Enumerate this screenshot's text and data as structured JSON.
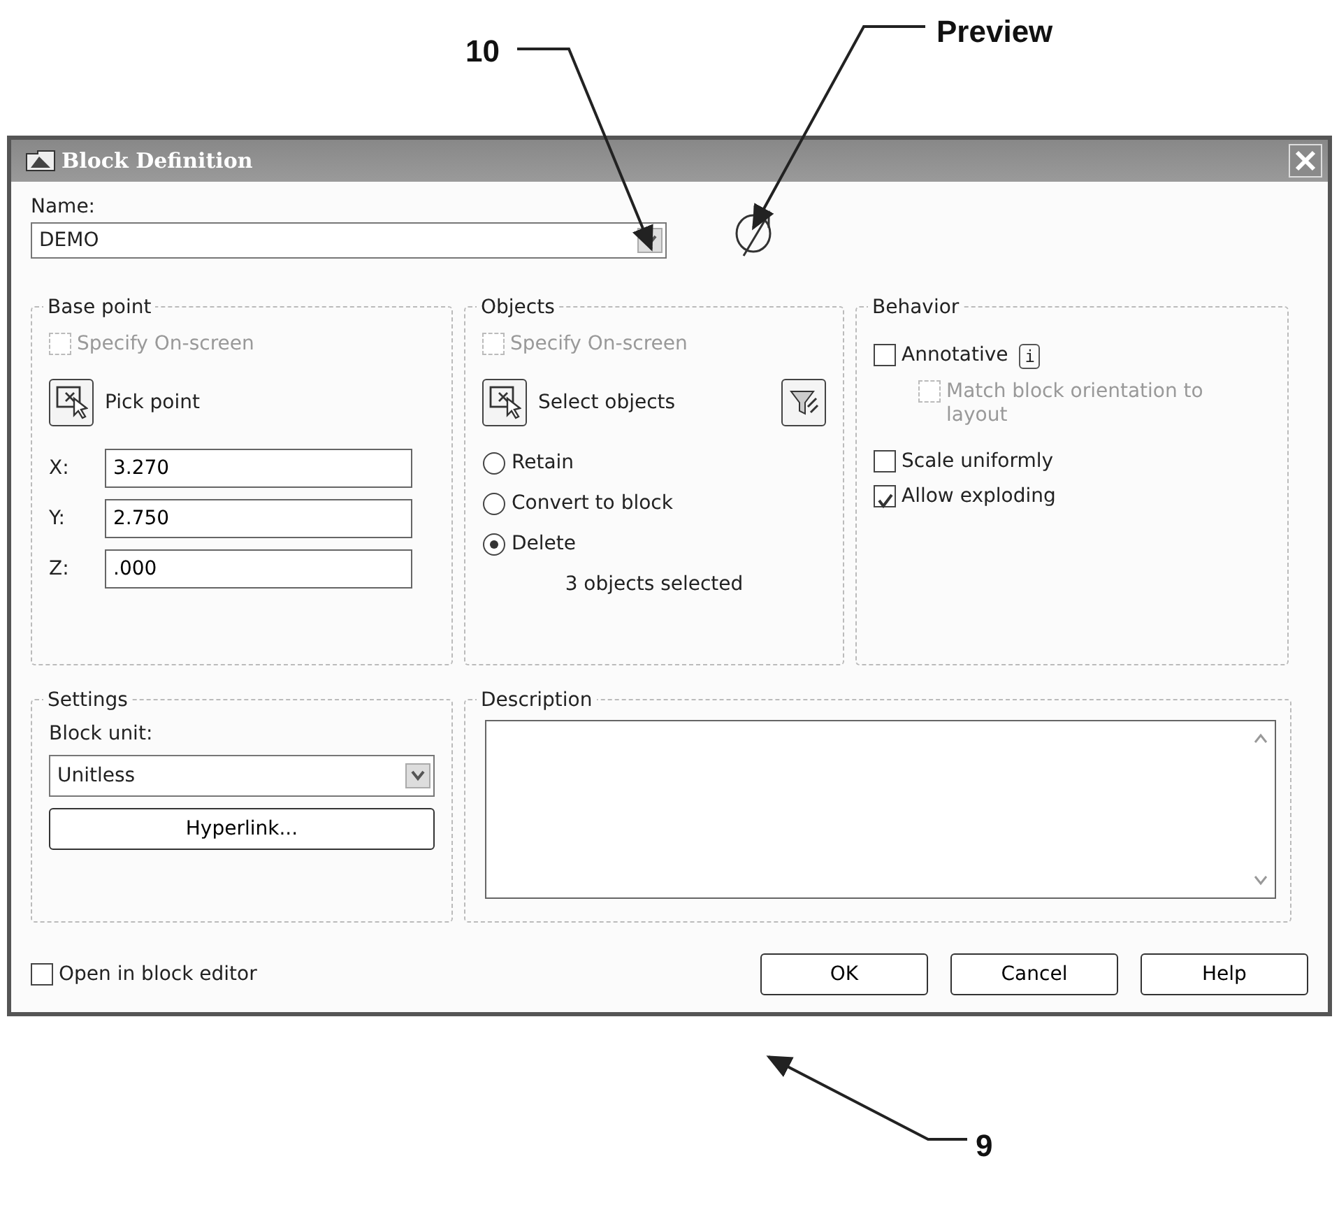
{
  "callouts": [
    {
      "label": "10"
    },
    {
      "label": "Preview"
    },
    {
      "label": "9"
    }
  ],
  "window": {
    "title": "Block Definition"
  },
  "name": {
    "label": "Name:",
    "value": "DEMO"
  },
  "base_point": {
    "title": "Base point",
    "specify": {
      "label": "Specify On-screen",
      "checked": false,
      "disabled": true
    },
    "pick_button": "Pick point",
    "coords": [
      {
        "label": "X:",
        "value": "3.270"
      },
      {
        "label": "Y:",
        "value": "2.750"
      },
      {
        "label": "Z:",
        "value": ".000"
      }
    ]
  },
  "objects": {
    "title": "Objects",
    "specify": {
      "label": "Specify On-screen",
      "checked": false,
      "disabled": true
    },
    "select_button": "Select objects",
    "options": [
      {
        "label": "Retain",
        "selected": false
      },
      {
        "label": "Convert to block",
        "selected": false
      },
      {
        "label": "Delete",
        "selected": true
      }
    ],
    "status": "3 objects selected"
  },
  "behavior": {
    "title": "Behavior",
    "items": [
      {
        "label": "Annotative",
        "checked": false,
        "disabled": false,
        "info": "i",
        "children": [
          {
            "label": "Match block orientation to layout",
            "checked": false,
            "disabled": true
          }
        ]
      },
      {
        "label": "Scale uniformly",
        "checked": false,
        "disabled": false
      },
      {
        "label": "Allow exploding",
        "checked": true,
        "disabled": false
      }
    ]
  },
  "settings": {
    "title": "Settings",
    "unit_label": "Block unit:",
    "unit_value": "Unitless",
    "hyperlink_button": "Hyperlink..."
  },
  "description": {
    "title": "Description"
  },
  "open_in_editor": {
    "label": "Open in block editor",
    "checked": false
  },
  "buttons": [
    "OK",
    "Cancel",
    "Help"
  ]
}
